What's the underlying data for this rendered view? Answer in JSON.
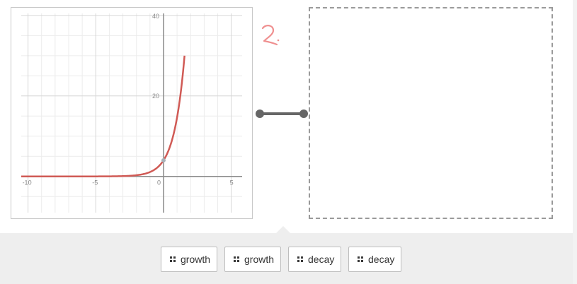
{
  "graph": {
    "function": "exponential growth",
    "x_axis": {
      "min": -10.5,
      "max": 5.8,
      "ticks": [
        -10,
        -5,
        0,
        5
      ]
    },
    "y_axis": {
      "min": -9,
      "max": 40.5,
      "ticks": [
        20,
        40
      ]
    },
    "tick_labels": {
      "x_neg10": "-10",
      "x_neg5": "-5",
      "x_0": "0",
      "x_5": "5",
      "y_20": "20",
      "y_40": "40"
    },
    "curve": {
      "formula": "y = 4 * e^(1.3 x)",
      "color": "#d05a55"
    },
    "point": {
      "x": 0,
      "y": 4
    }
  },
  "annotation": {
    "text": "2."
  },
  "connector": {
    "color": "#666666"
  },
  "drop_zone": {
    "label": ""
  },
  "tray": {
    "cards": [
      {
        "label": "growth"
      },
      {
        "label": "growth"
      },
      {
        "label": "decay"
      },
      {
        "label": "decay"
      }
    ]
  }
}
